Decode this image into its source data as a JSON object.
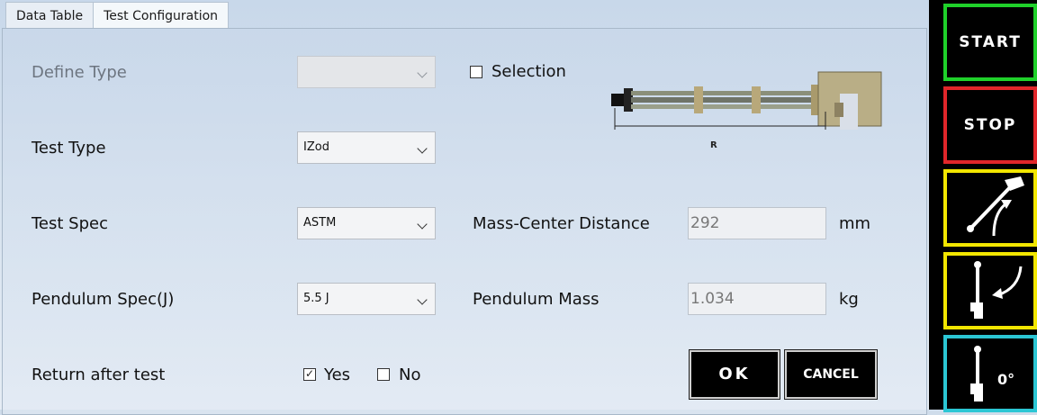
{
  "tabs": [
    {
      "label": "Data Table",
      "active": false
    },
    {
      "label": "Test Configuration",
      "active": true
    }
  ],
  "form": {
    "define_type": {
      "label": "Define Type",
      "value": "",
      "disabled": true
    },
    "selection": {
      "label": "Selection",
      "checked": false
    },
    "test_type": {
      "label": "Test Type",
      "value": "IZod"
    },
    "test_spec": {
      "label": "Test Spec",
      "value": "ASTM"
    },
    "pendulum_spec": {
      "label": "Pendulum Spec(J)",
      "value": "5.5 J"
    },
    "mass_center": {
      "label": "Mass-Center Distance",
      "value": "292",
      "unit": "mm"
    },
    "pendulum_mass": {
      "label": "Pendulum Mass",
      "value": "1.034",
      "unit": "kg"
    },
    "return_after": {
      "label": "Return after test",
      "yes_label": "Yes",
      "yes_checked": true,
      "no_label": "No",
      "no_checked": false
    }
  },
  "diagram": {
    "r_label": "R"
  },
  "buttons": {
    "ok": "OK",
    "cancel": "CANCEL"
  },
  "sidebar": {
    "start": {
      "label": "START",
      "border": "#1fd12a"
    },
    "stop": {
      "label": "STOP",
      "border": "#e0262a"
    },
    "release": {
      "icon": "pendulum-release-icon",
      "border": "#f2e600"
    },
    "return": {
      "icon": "pendulum-return-icon",
      "border": "#f2e600"
    },
    "zero": {
      "icon": "pendulum-zero-icon",
      "label": "0°",
      "border": "#2bc6d4"
    }
  }
}
